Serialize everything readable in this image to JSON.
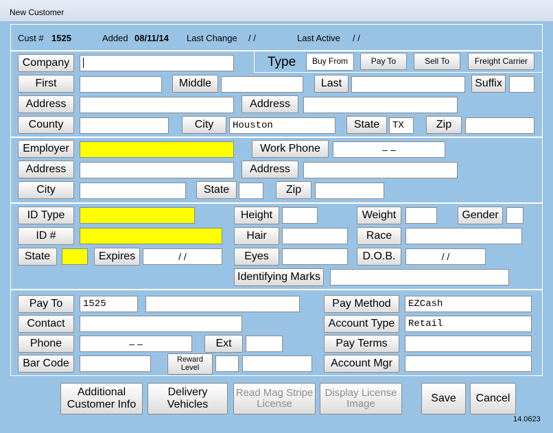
{
  "window": {
    "title": "New Customer"
  },
  "info": {
    "cust_label": "Cust #",
    "cust_value": "1525",
    "added_label": "Added",
    "added_value": "08/11/14",
    "last_change_label": "Last Change",
    "last_change_value": "/  /",
    "last_active_label": "Last Active",
    "last_active_value": "/  /"
  },
  "type_row": {
    "company_btn": "Company",
    "company_value": "",
    "type_label": "Type",
    "buy_from": "Buy From",
    "pay_to": "Pay To",
    "sell_to": "Sell To",
    "freight_carrier": "Freight Carrier"
  },
  "name_row": {
    "first_btn": "First",
    "first_value": "",
    "middle_btn": "Middle",
    "middle_value": "",
    "last_btn": "Last",
    "last_value": "",
    "suffix_btn": "Suffix",
    "suffix_value": ""
  },
  "address_row": {
    "address1_btn": "Address",
    "address1_value": "",
    "address2_btn": "Address",
    "address2_value": ""
  },
  "county_row": {
    "county_btn": "County",
    "county_value": "",
    "city_btn": "City",
    "city_value": "Houston",
    "state_btn": "State",
    "state_value": "TX",
    "zip_btn": "Zip",
    "zip_value": ""
  },
  "employer": {
    "employer_btn": "Employer",
    "employer_value": "",
    "work_phone_btn": "Work Phone",
    "work_phone_value": "–     –",
    "address1_btn": "Address",
    "address1_value": "",
    "address2_btn": "Address",
    "address2_value": "",
    "city_btn": "City",
    "city_value": "",
    "state_btn": "State",
    "state_value": "",
    "zip_btn": "Zip",
    "zip_value": ""
  },
  "id_section": {
    "id_type_btn": "ID Type",
    "id_type_value": "",
    "id_num_btn": "ID #",
    "id_num_value": "",
    "state_btn": "State",
    "state_value": "",
    "expires_btn": "Expires",
    "expires_value": "/   /",
    "height_btn": "Height",
    "height_value": "",
    "hair_btn": "Hair",
    "hair_value": "",
    "eyes_btn": "Eyes",
    "eyes_value": "",
    "weight_btn": "Weight",
    "weight_value": "",
    "gender_btn": "Gender",
    "gender_value": "",
    "race_btn": "Race",
    "race_value": "",
    "dob_btn": "D.O.B.",
    "dob_value": "/   /",
    "marks_btn": "Identifying Marks",
    "marks_value": ""
  },
  "pay_section": {
    "pay_to_btn": "Pay To",
    "pay_to_value": "1525",
    "pay_to_name": "",
    "contact_btn": "Contact",
    "contact_value": "",
    "phone_btn": "Phone",
    "phone_value": "–     –",
    "ext_btn": "Ext",
    "ext_value": "",
    "bar_code_btn": "Bar Code",
    "bar_code_value": "",
    "reward_level_btn": "Reward Level",
    "reward_level_value": "",
    "reward_extra_value": "",
    "pay_method_btn": "Pay Method",
    "pay_method_value": "EZCash",
    "account_type_btn": "Account Type",
    "account_type_value": "Retail",
    "pay_terms_btn": "Pay Terms",
    "pay_terms_value": "",
    "account_mgr_btn": "Account Mgr",
    "account_mgr_value": ""
  },
  "footer": {
    "additional_info": "Additional Customer Info",
    "delivery_vehicles": "Delivery Vehicles",
    "read_mag_stripe": "Read Mag Stripe License",
    "display_license": "Display License Image",
    "save": "Save",
    "cancel": "Cancel",
    "version": "14.0623"
  }
}
